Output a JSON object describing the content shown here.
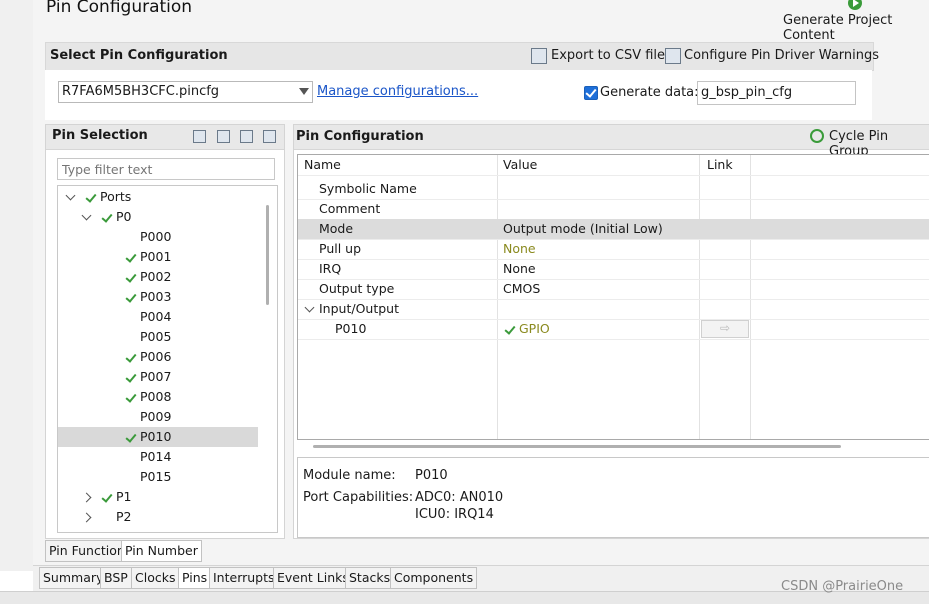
{
  "editor": {
    "title": "Pin Configuration",
    "generate_label": "Generate Project Content"
  },
  "select_section": {
    "title": "Select Pin Configuration",
    "export_label": "Export to CSV file",
    "configure_label": "Configure Pin Driver Warnings",
    "config_value": "R7FA6M5BH3CFC.pincfg",
    "manage_label": "Manage configurations...",
    "generate_data_label": "Generate data:",
    "generate_data_checked": true,
    "generate_data_value": "g_bsp_pin_cfg"
  },
  "pin_selection": {
    "title": "Pin Selection",
    "filter_placeholder": "Type filter text",
    "tree": [
      {
        "label": "Ports",
        "level": 0,
        "expanded": true,
        "check": true
      },
      {
        "label": "P0",
        "level": 1,
        "expanded": true,
        "check": true
      },
      {
        "label": "P000",
        "level": 2,
        "check": false
      },
      {
        "label": "P001",
        "level": 2,
        "check": true
      },
      {
        "label": "P002",
        "level": 2,
        "check": true
      },
      {
        "label": "P003",
        "level": 2,
        "check": true
      },
      {
        "label": "P004",
        "level": 2,
        "check": false
      },
      {
        "label": "P005",
        "level": 2,
        "check": false
      },
      {
        "label": "P006",
        "level": 2,
        "check": true
      },
      {
        "label": "P007",
        "level": 2,
        "check": true
      },
      {
        "label": "P008",
        "level": 2,
        "check": true
      },
      {
        "label": "P009",
        "level": 2,
        "check": false
      },
      {
        "label": "P010",
        "level": 2,
        "check": true,
        "selected": true
      },
      {
        "label": "P014",
        "level": 2,
        "check": false
      },
      {
        "label": "P015",
        "level": 2,
        "check": false
      },
      {
        "label": "P1",
        "level": 1,
        "expanded": false,
        "check": true
      },
      {
        "label": "P2",
        "level": 1,
        "expanded": false,
        "check": false
      }
    ],
    "tabs": [
      "Pin Function",
      "Pin Number"
    ]
  },
  "pin_config": {
    "title": "Pin Configuration",
    "cycle_label": "Cycle Pin Group",
    "columns": [
      "Name",
      "Value",
      "Link"
    ],
    "rows": [
      {
        "name": "Symbolic Name",
        "value": ""
      },
      {
        "name": "Comment",
        "value": ""
      },
      {
        "name": "Mode",
        "value": "Output mode (Initial Low)"
      },
      {
        "name": "Pull up",
        "value": "None"
      },
      {
        "name": "IRQ",
        "value": "None"
      },
      {
        "name": "Output type",
        "value": "CMOS"
      },
      {
        "name": "Input/Output",
        "value": ""
      },
      {
        "name": "P010",
        "value": "GPIO"
      }
    ],
    "module_name_label": "Module name:",
    "module_name_value": "P010",
    "port_cap_label": "Port Capabilities:",
    "port_cap_1": "ADC0: AN010",
    "port_cap_2": "ICU0: IRQ14"
  },
  "bottom_tabs": [
    "Summary",
    "BSP",
    "Clocks",
    "Pins",
    "Interrupts",
    "Event Links",
    "Stacks",
    "Components"
  ],
  "watermark": "CSDN @PrairieOne",
  "colors": {
    "accent": "#1a55c8",
    "check": "#3b9a3b",
    "olive": "#8a8a1f"
  }
}
